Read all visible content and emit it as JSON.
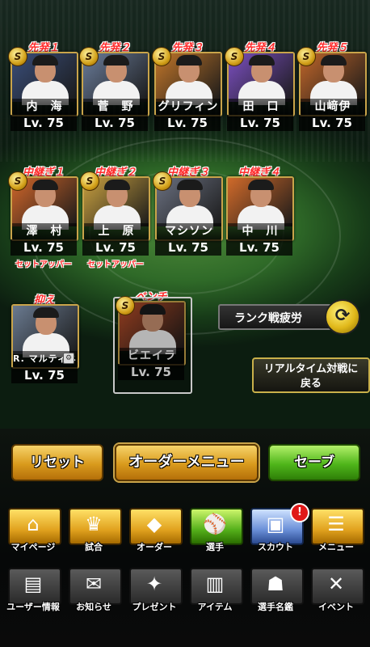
{
  "starters": [
    {
      "slot_label": "先発１",
      "name": "内　海",
      "lv": "Lv. 75",
      "badge": "S",
      "bg": "#3a4e7a"
    },
    {
      "slot_label": "先発２",
      "name": "菅　野",
      "lv": "Lv. 75",
      "badge": "S",
      "bg": "#6a7c9a"
    },
    {
      "slot_label": "先発３",
      "name": "グリフィン",
      "lv": "Lv. 75",
      "badge": "S",
      "bg": "#c1762a"
    },
    {
      "slot_label": "先発４",
      "name": "田　口",
      "lv": "Lv. 75",
      "badge": "S",
      "bg": "#7b4fc0"
    },
    {
      "slot_label": "先発５",
      "name": "山﨑伊",
      "lv": "Lv. 75",
      "badge": "S",
      "bg": "#c0662a"
    }
  ],
  "relievers": [
    {
      "slot_label": "中継ぎ１",
      "name": "澤　村",
      "lv": "Lv. 75",
      "badge": "S",
      "bg": "#d0662a",
      "sub": "セットアッパー"
    },
    {
      "slot_label": "中継ぎ２",
      "name": "上　原",
      "lv": "Lv. 75",
      "badge": "S",
      "bg": "#c8a040",
      "sub": "セットアッパー"
    },
    {
      "slot_label": "中継ぎ３",
      "name": "マシソン",
      "lv": "Lv. 75",
      "badge": "S",
      "bg": "#6a7080",
      "sub": ""
    },
    {
      "slot_label": "中継ぎ４",
      "name": "中　川",
      "lv": "Lv. 75",
      "badge": "",
      "bg": "#d06a2a",
      "sub": ""
    }
  ],
  "closer": {
    "slot_label": "抑え",
    "name": "R. マルティネス",
    "lv": "Lv. 75",
    "badge": "",
    "bg": "#6a7a90"
  },
  "bench": {
    "slot_label": "ベンチ",
    "name": "ビエイラ",
    "lv": "Lv. 75",
    "badge": "S",
    "bg": "#c0502a"
  },
  "rank_fatigue_label": "ランク戦疲労",
  "realtime_label_line1": "リアルタイム対戦に",
  "realtime_label_line2": "戻る",
  "buttons": {
    "reset": "リセット",
    "order_menu": "オーダーメニュー",
    "save": "セーブ"
  },
  "nav_row1": [
    {
      "label": "マイページ",
      "icon": "home-icon",
      "glyph": "⌂",
      "style": ""
    },
    {
      "label": "試合",
      "icon": "trophy-icon",
      "glyph": "♛",
      "style": ""
    },
    {
      "label": "オーダー",
      "icon": "order-icon",
      "glyph": "◆",
      "style": ""
    },
    {
      "label": "選手",
      "icon": "player-icon",
      "glyph": "⚾",
      "style": "green"
    },
    {
      "label": "スカウト",
      "icon": "scout-card-icon",
      "glyph": "▣",
      "style": "blue",
      "notify": "!"
    },
    {
      "label": "メニュー",
      "icon": "menu-icon",
      "glyph": "☰",
      "style": ""
    }
  ],
  "nav_row2": [
    {
      "label": "ユーザー情報",
      "icon": "user-info-icon",
      "glyph": "▤"
    },
    {
      "label": "お知らせ",
      "icon": "notice-icon",
      "glyph": "✉"
    },
    {
      "label": "プレゼント",
      "icon": "gift-icon",
      "glyph": "✦"
    },
    {
      "label": "アイテム",
      "icon": "item-icon",
      "glyph": "▥"
    },
    {
      "label": "選手名鑑",
      "icon": "player-book-icon",
      "glyph": "☗"
    },
    {
      "label": "イベント",
      "icon": "event-icon",
      "glyph": "✕"
    }
  ]
}
